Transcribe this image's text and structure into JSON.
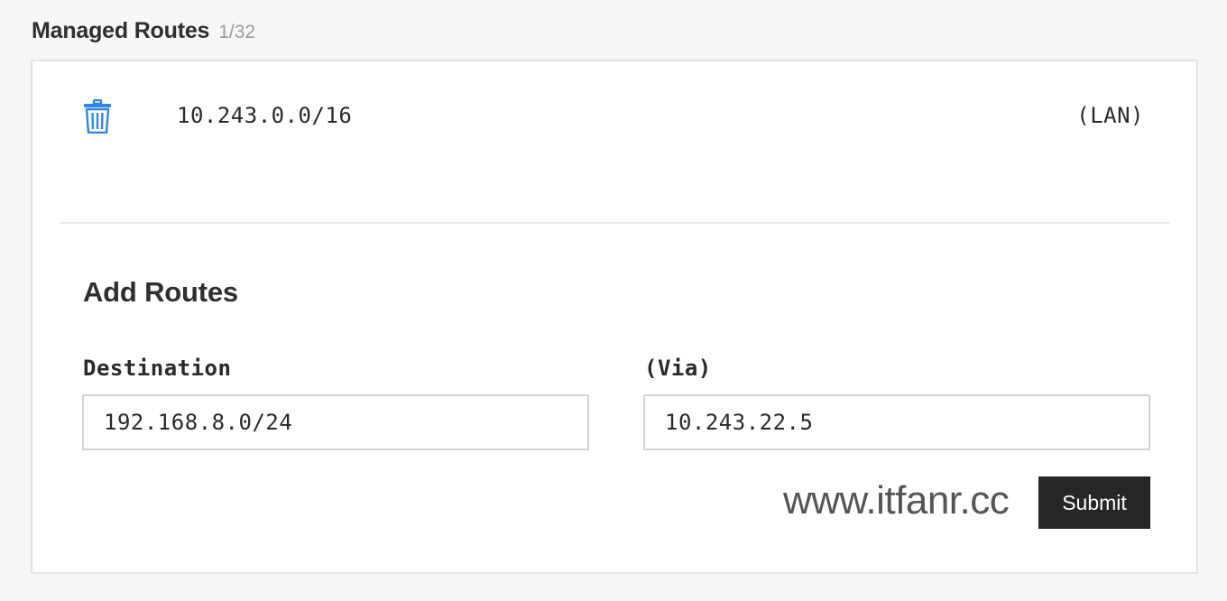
{
  "header": {
    "title": "Managed Routes",
    "count": "1/32"
  },
  "routes": [
    {
      "destination": "10.243.0.0/16",
      "via": "(LAN)",
      "delete_icon": "trash-icon",
      "icon_color": "#2f86e6"
    }
  ],
  "add_routes": {
    "title": "Add Routes",
    "destination_label": "Destination",
    "destination_value": "192.168.8.0/24",
    "via_label": "(Via)",
    "via_value": "10.243.22.5",
    "submit_label": "Submit"
  },
  "watermark": {
    "text": "www.itfanr.cc"
  },
  "colors": {
    "accent": "#2f86e6",
    "button_bg": "#262626",
    "background": "#f7f7f7"
  }
}
